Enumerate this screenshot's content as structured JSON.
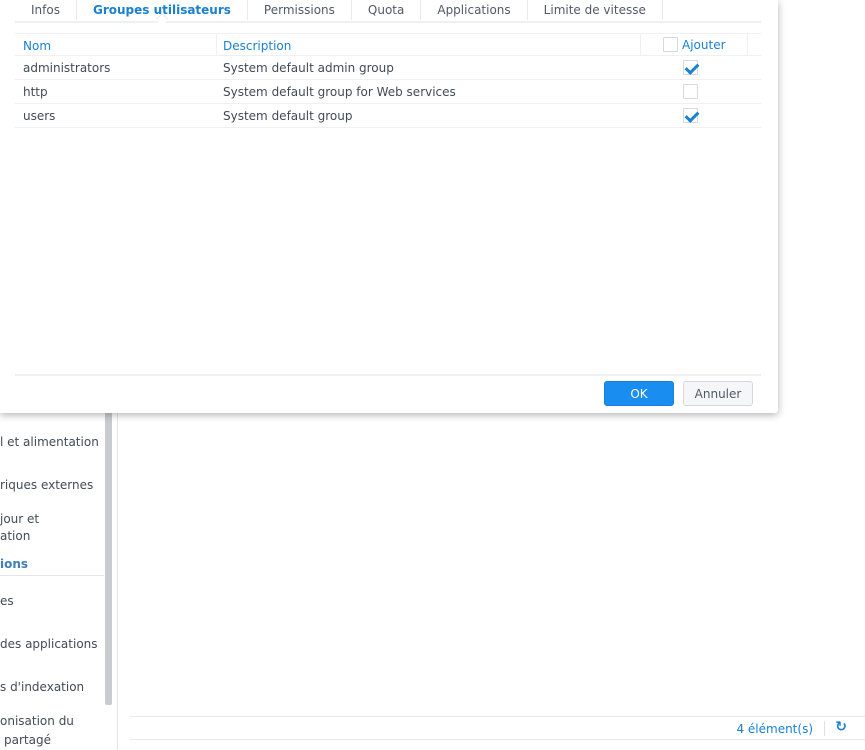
{
  "dialog": {
    "tabs": [
      "Infos",
      "Groupes utilisateurs",
      "Permissions",
      "Quota",
      "Applications",
      "Limite de vitesse"
    ],
    "active_tab": 1,
    "columns": {
      "name": "Nom",
      "description": "Description",
      "add": "Ajouter"
    },
    "rows": [
      {
        "name": "administrators",
        "description": "System default admin group",
        "checked": true
      },
      {
        "name": "http",
        "description": "System default group for Web services",
        "checked": false
      },
      {
        "name": "users",
        "description": "System default group",
        "checked": true
      }
    ],
    "ok_label": "OK",
    "cancel_label": "Annuler"
  },
  "sidebar": {
    "items": [
      "l et alimentation",
      "riques externes",
      "jour et",
      "ation",
      "ions",
      "es",
      "des applications",
      "s d'indexation",
      "onisation du",
      "partagé"
    ]
  },
  "status": {
    "count": "4 élément(s)",
    "refresh_icon": "refresh-icon"
  },
  "colors": {
    "accent": "#1a80d0",
    "ok_button": "#1a8ef0"
  }
}
